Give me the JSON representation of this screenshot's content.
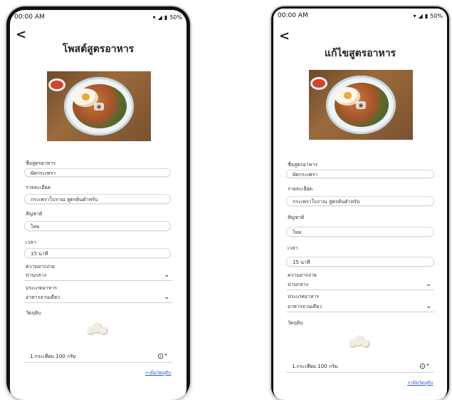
{
  "status": {
    "time": "00:00 AM",
    "battery": "50%"
  },
  "screens": {
    "post": {
      "title": "โพสต์สูตรอาหาร"
    },
    "edit": {
      "title": "แก้ไขสูตรอาหาร"
    }
  },
  "form": {
    "name_label": "ชื่อสูตรอาหาร",
    "name_value": "ผัดกระเพรา",
    "detail_label": "รายละเอียด",
    "detail_value": "กระเพราโบราณ สูตรต้นตำหรับ",
    "nationality_label": "สัญชาติ",
    "nationality_value": "ไทย",
    "time_label": "เวลา",
    "time_value": "15 นาที",
    "difficulty_label": "ความยากง่าย",
    "difficulty_value": "ปานกลาง",
    "type_label": "ประเภทอาหาร",
    "type_value": "อาหารจานเดียว",
    "ingredients_label": "วัตถุดิบ",
    "ingredient_item": "1.กระเทียม 100 กรัม",
    "add_ingredient": "+เพิ่มวัตถุดิบ"
  },
  "icons": {
    "back": "chevron-left-icon",
    "chevron": "chevron-down-icon",
    "camera": "camera-icon",
    "camera_add": "camera-add-icon",
    "wifi": "wifi-icon",
    "signal": "signal-icon",
    "battery": "battery-icon"
  },
  "colors": {
    "link": "#2b5fd9",
    "field_border": "#d8d8d8"
  }
}
